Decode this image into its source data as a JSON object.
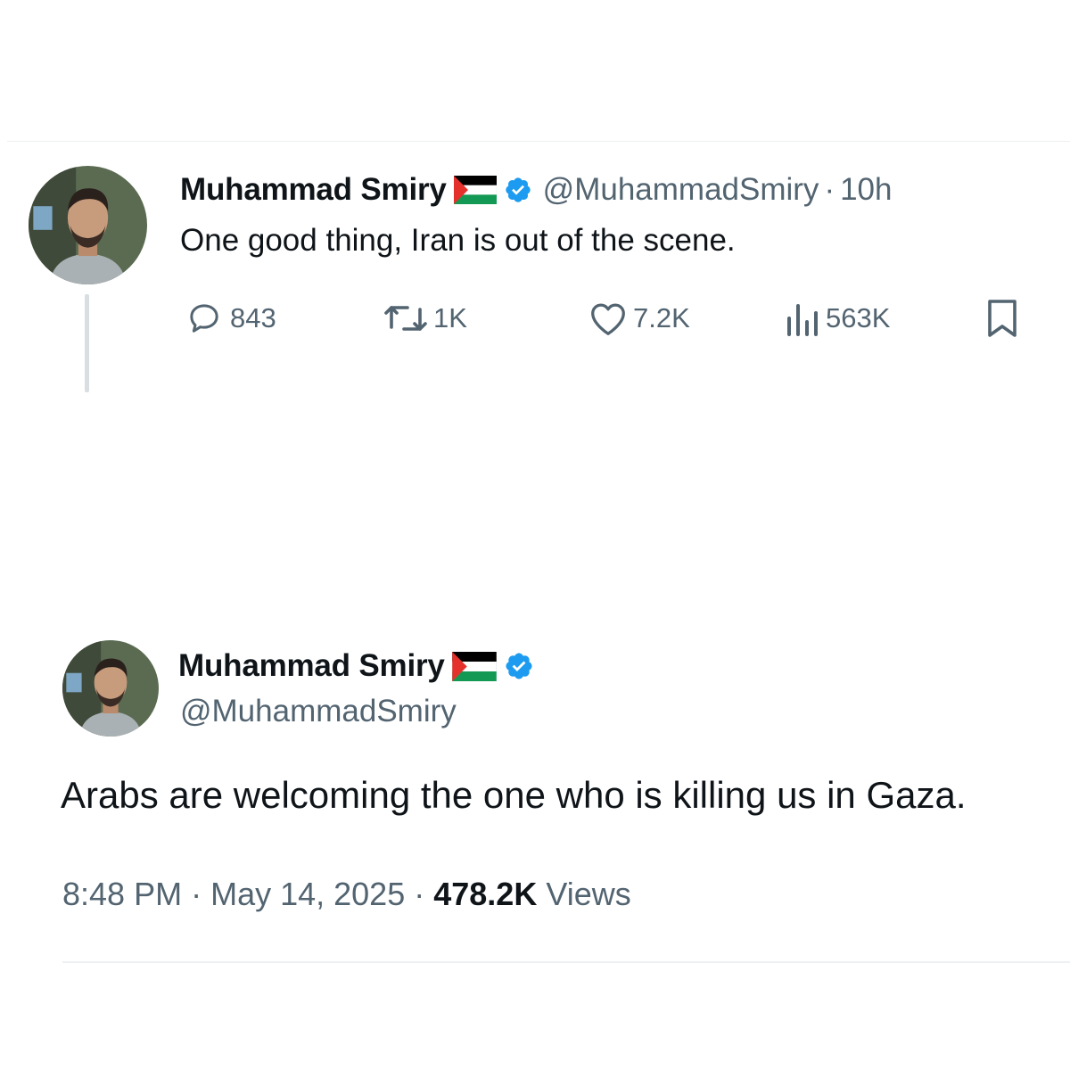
{
  "tweet1": {
    "display_name": "Muhammad Smiry",
    "handle": "@MuhammadSmiry",
    "separator": "·",
    "time_ago": "10h",
    "text": "One good thing, Iran is out of the scene.",
    "actions": {
      "replies": "843",
      "reposts": "1K",
      "likes": "7.2K",
      "views": "563K"
    }
  },
  "tweet2": {
    "display_name": "Muhammad Smiry",
    "handle": "@MuhammadSmiry",
    "text": "Arabs are welcoming the one who is killing us in Gaza.",
    "time": "8:48 PM",
    "separator1": " · ",
    "date": "May 14, 2025",
    "separator2": " · ",
    "views_count": "478.2K",
    "views_label": " Views"
  },
  "colors": {
    "text_primary": "#0f1419",
    "text_secondary": "#536471",
    "verified_blue": "#1d9bf0",
    "divider": "#eef1f3",
    "flag_black": "#000000",
    "flag_white": "#ffffff",
    "flag_green": "#149954",
    "flag_red": "#e4312b"
  },
  "icons": {
    "verified": "verified-badge-icon",
    "flag": "palestine-flag-icon",
    "reply": "reply-icon",
    "repost": "repost-icon",
    "like": "like-icon",
    "views": "views-icon",
    "bookmark": "bookmark-icon"
  }
}
